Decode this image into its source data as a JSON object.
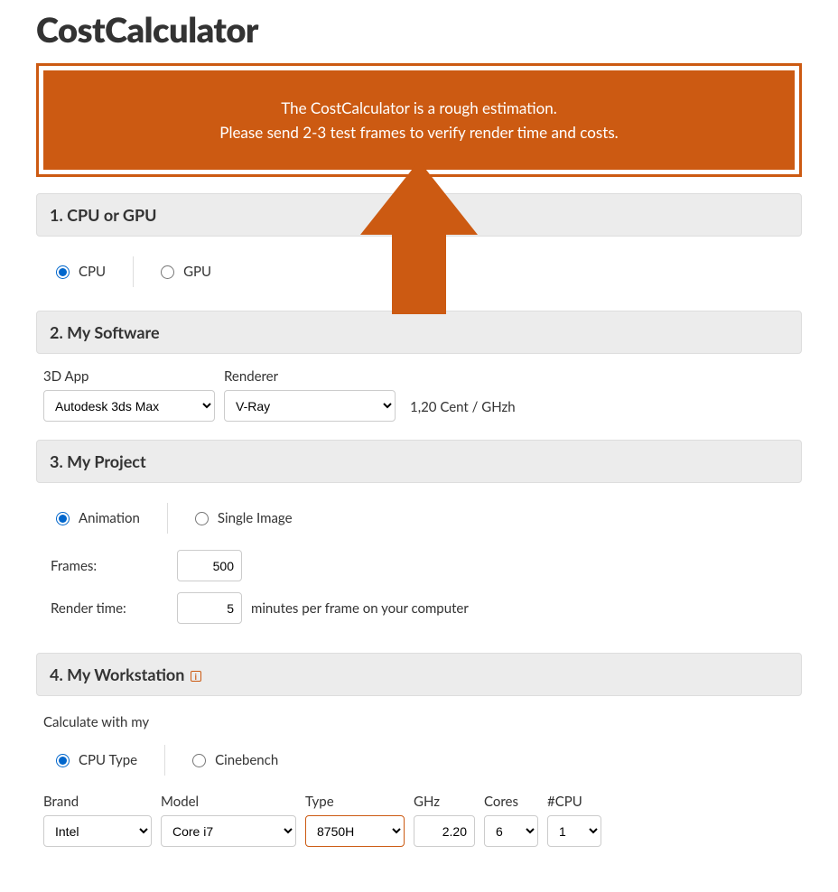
{
  "title": "CostCalculator",
  "notice": {
    "line1": "The CostCalculator is a rough estimation.",
    "line2": "Please send 2-3 test frames to verify render time and costs."
  },
  "section1": {
    "heading": "1. CPU or GPU",
    "cpu_label": "CPU",
    "gpu_label": "GPU"
  },
  "section2": {
    "heading": "2. My Software",
    "app_label": "3D App",
    "app_value": "Autodesk 3ds Max",
    "renderer_label": "Renderer",
    "renderer_value": "V-Ray",
    "rate": "1,20 Cent / GHzh"
  },
  "section3": {
    "heading": "3. My Project",
    "anim_label": "Animation",
    "single_label": "Single Image",
    "frames_label": "Frames:",
    "frames_value": "500",
    "rtime_label": "Render time:",
    "rtime_value": "5",
    "rtime_suffix": "minutes per frame on your computer"
  },
  "section4": {
    "heading": "4. My Workstation",
    "calc_label": "Calculate with my",
    "cputype_label": "CPU Type",
    "cinebench_label": "Cinebench",
    "brand_label": "Brand",
    "brand_value": "Intel",
    "model_label": "Model",
    "model_value": "Core i7",
    "type_label": "Type",
    "type_value": "8750H",
    "ghz_label": "GHz",
    "ghz_value": "2.20",
    "cores_label": "Cores",
    "cores_value": "6",
    "cpus_label": "#CPU",
    "cpus_value": "1"
  }
}
